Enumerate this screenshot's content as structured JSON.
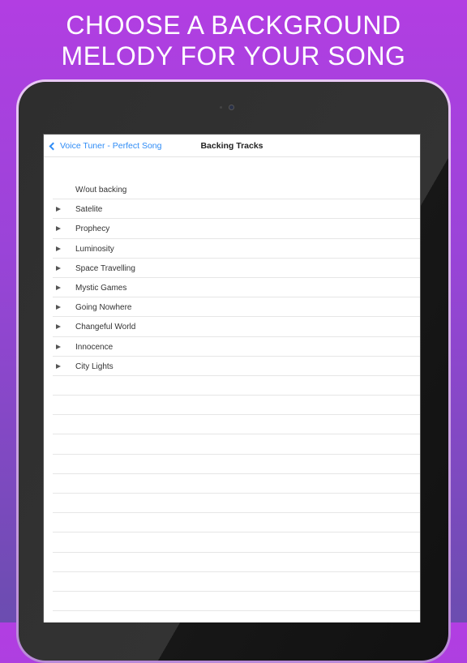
{
  "headline": {
    "line1": "CHOOSE A BACKGROUND",
    "line2": "MELODY FOR YOUR SONG"
  },
  "nav": {
    "back_label": "Voice Tuner - Perfect Song",
    "title": "Backing Tracks"
  },
  "tracks": [
    {
      "label": "W/out backing",
      "icon": null
    },
    {
      "label": "Satelite",
      "icon": "play-icon"
    },
    {
      "label": "Prophecy",
      "icon": "play-icon"
    },
    {
      "label": "Luminosity",
      "icon": "play-icon"
    },
    {
      "label": "Space Travelling",
      "icon": "play-icon"
    },
    {
      "label": "Mystic Games",
      "icon": "play-icon"
    },
    {
      "label": "Going Nowhere",
      "icon": "play-icon"
    },
    {
      "label": "Changeful World",
      "icon": "play-icon"
    },
    {
      "label": "Innocence",
      "icon": "play-icon"
    },
    {
      "label": "City Lights",
      "icon": "play-icon"
    }
  ],
  "colors": {
    "accent": "#2f8cf6"
  }
}
